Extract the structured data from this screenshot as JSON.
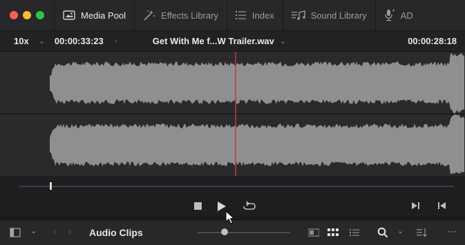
{
  "window": {
    "traffic_lights": [
      "#fe5f57",
      "#febc2e",
      "#28c840"
    ]
  },
  "tabs": [
    {
      "label": "Media Pool",
      "icon": "media-pool-icon",
      "active": true
    },
    {
      "label": "Effects Library",
      "icon": "effects-wand-icon",
      "active": false
    },
    {
      "label": "Index",
      "icon": "index-list-icon",
      "active": false
    },
    {
      "label": "Sound Library",
      "icon": "sound-library-icon",
      "active": false
    },
    {
      "label": "AD",
      "icon": "adr-mic-icon",
      "active": false
    }
  ],
  "viewer": {
    "zoom": "10x",
    "timecode_left": "00:00:33:23",
    "clip_name": "Get With Me f...W Trailer.wav",
    "timecode_right": "00:00:28:18",
    "playhead_color": "#c43b3b",
    "waveform_color": "#8f8f92"
  },
  "transport": {
    "stop": "stop-icon",
    "play": "play-icon",
    "loop": "loop-icon",
    "next": "next-frame-icon",
    "prev": "prev-clip-icon"
  },
  "bottom": {
    "bin_label": "Audio Clips",
    "icons": [
      "sidebar-toggle-icon",
      "chevron-down-icon",
      "back-arrow-icon",
      "forward-arrow-icon",
      "thumbnail-view-icon",
      "grid-view-icon",
      "list-view-icon",
      "search-icon",
      "sort-icon",
      "more-icon"
    ]
  }
}
